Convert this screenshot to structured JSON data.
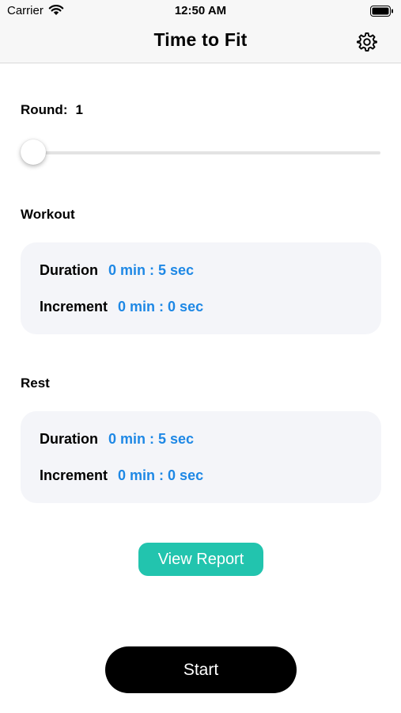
{
  "status_bar": {
    "carrier": "Carrier",
    "time": "12:50 AM"
  },
  "nav": {
    "title": "Time to Fit",
    "settings_icon": "gear-icon"
  },
  "round": {
    "label": "Round:",
    "value": "1",
    "slider_fraction": 0
  },
  "workout": {
    "title": "Workout",
    "duration_label": "Duration",
    "duration_value": "0 min : 5 sec",
    "increment_label": "Increment",
    "increment_value": "0 min : 0 sec"
  },
  "rest": {
    "title": "Rest",
    "duration_label": "Duration",
    "duration_value": "0 min : 5 sec",
    "increment_label": "Increment",
    "increment_value": "0 min : 0 sec"
  },
  "buttons": {
    "view_report": "View Report",
    "start": "Start"
  },
  "colors": {
    "accent_blue": "#1e88e5",
    "report_green": "#22c4ae",
    "start_black": "#000000",
    "card_bg": "#f4f5f9"
  }
}
